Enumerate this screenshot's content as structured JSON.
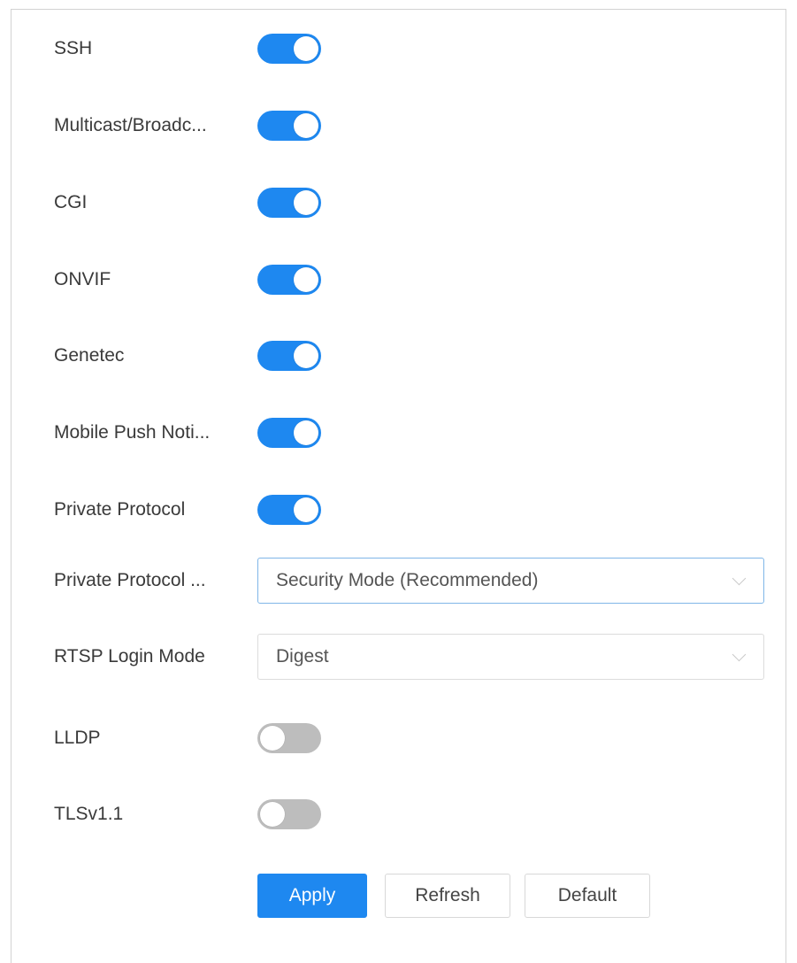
{
  "caption": {
    "text": ""
  },
  "settings": [
    {
      "label": "SSH",
      "type": "toggle",
      "state": "on"
    },
    {
      "label": "Multicast/Broadc...",
      "type": "toggle",
      "state": "on"
    },
    {
      "label": "CGI",
      "type": "toggle",
      "state": "on"
    },
    {
      "label": "ONVIF",
      "type": "toggle",
      "state": "on"
    },
    {
      "label": "Genetec",
      "type": "toggle",
      "state": "on"
    },
    {
      "label": "Mobile Push Noti...",
      "type": "toggle",
      "state": "on"
    },
    {
      "label": "Private Protocol",
      "type": "toggle",
      "state": "on"
    },
    {
      "label": "Private Protocol ...",
      "type": "select",
      "value": "Security Mode (Recommended)"
    },
    {
      "label": "RTSP Login Mode",
      "type": "select",
      "value": "Digest"
    },
    {
      "label": "LLDP",
      "type": "toggle",
      "state": "off"
    },
    {
      "label": "TLSv1.1",
      "type": "toggle",
      "state": "off"
    }
  ],
  "buttons": {
    "apply": "Apply",
    "refresh": "Refresh",
    "default": "Default"
  },
  "colors": {
    "accent": "#1e88f0",
    "toggle_off": "#bdbdbd",
    "focus_border": "#7fb6e8"
  },
  "icons": {
    "select_arrow": "chevron-down-icon"
  }
}
